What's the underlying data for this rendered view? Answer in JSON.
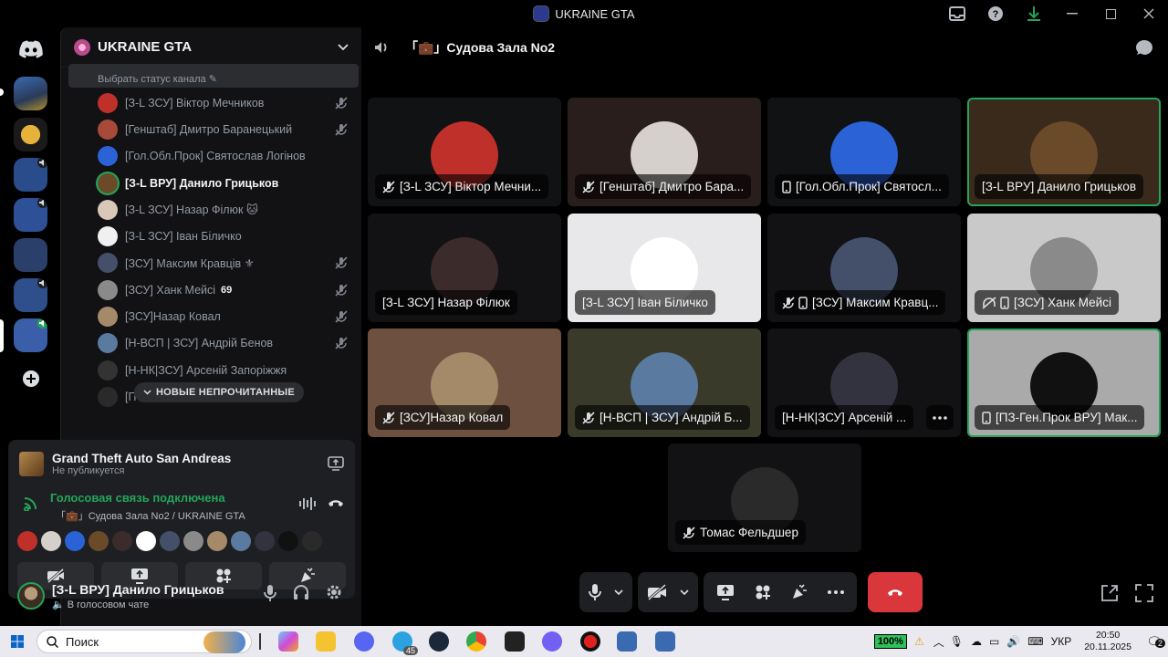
{
  "window": {
    "title": "UKRAINE GTA"
  },
  "guild": {
    "name": "UKRAINE GTA",
    "channel_status_placeholder": "Выбрать статус канала"
  },
  "members": [
    {
      "name": "[З-L ЗСУ] Віктор Мечников",
      "muted": true,
      "bold": false,
      "color": "#c0302a"
    },
    {
      "name": "[Генштаб] Дмитро Баранецький",
      "muted": true,
      "bold": false,
      "color": "#a84a3a"
    },
    {
      "name": "[Гол.Обл.Прок] Святослав Логінов",
      "muted": false,
      "bold": false,
      "color": "#2b62d6"
    },
    {
      "name": "[З-L ВРУ] Данило Грицьков",
      "muted": false,
      "bold": true,
      "color": "#6b4a2a"
    },
    {
      "name": "[З-L ЗСУ] Назар Філюк 🐱",
      "muted": false,
      "bold": false,
      "color": "#d9c7b8"
    },
    {
      "name": "[З-L ЗСУ] Іван Біличко",
      "muted": false,
      "bold": false,
      "color": "#f0f0f0"
    },
    {
      "name": "[ЗСУ] Максим Кравців ⚜",
      "muted": true,
      "bold": false,
      "color": "#44506a"
    },
    {
      "name": "[ЗСУ] Ханк Мейсі",
      "muted": true,
      "bold": false,
      "color": "#8a8a8a",
      "badge": "69"
    },
    {
      "name": "[ЗСУ]Назар Ковал",
      "muted": true,
      "bold": false,
      "color": "#a58a6a"
    },
    {
      "name": "[Н-ВСП | ЗСУ] Андрій Бенов",
      "muted": true,
      "bold": false,
      "color": "#5a7aa0"
    },
    {
      "name": "[Н-НК|ЗСУ] Арсеній Запоріжжя",
      "muted": false,
      "bold": false,
      "color": "#333"
    },
    {
      "name": "[П                    ісон",
      "muted": false,
      "bold": false,
      "color": "#2a2a2a"
    }
  ],
  "unread_banner": "НОВЫЕ НЕПРОЧИТАННЫЕ",
  "activity": {
    "game": "Grand Theft Auto San Andreas",
    "status": "Не публикуется"
  },
  "voice": {
    "status": "Голосовая связь подключена",
    "channel": "「💼」Судова Зала No2 / UKRAINE GTA"
  },
  "user": {
    "name": "[З-L ВРУ] Данило Грицьков",
    "status": "В голосовом чате"
  },
  "stage": {
    "channel_title": "「💼」Судова Зала No2"
  },
  "tiles": [
    {
      "label": "[З-L ЗСУ] Віктор Мечни...",
      "icon": "mic-off",
      "bg": "#111214",
      "av": "#c0302a",
      "speaking": false,
      "dots": false
    },
    {
      "label": "[Генштаб] Дмитро Бара...",
      "icon": "mic-off",
      "bg": "#2a1e1c",
      "av": "#d6d0cc",
      "speaking": false,
      "dots": false
    },
    {
      "label": "[Гол.Обл.Прок] Святосл...",
      "icon": "phone",
      "bg": "#111214",
      "av": "#2b62d6",
      "speaking": false,
      "dots": false
    },
    {
      "label": "[З-L ВРУ] Данило Грицьков",
      "icon": "",
      "bg": "#3a2a1c",
      "av": "#6b4a2a",
      "speaking": true,
      "dots": false
    },
    {
      "label": "[З-L ЗСУ] Назар Філюк",
      "icon": "",
      "bg": "#121214",
      "av": "#3b2b2b",
      "speaking": false,
      "dots": false
    },
    {
      "label": "[З-L ЗСУ] Іван Біличко",
      "icon": "",
      "bg": "#e8e8ea",
      "av": "#ffffff",
      "speaking": false,
      "dots": false
    },
    {
      "label": "[ЗСУ] Максим Кравц...",
      "icon": "mic-off-phone",
      "bg": "#121214",
      "av": "#44506a",
      "speaking": false,
      "dots": false
    },
    {
      "label": "[ЗСУ] Ханк Мейсі",
      "icon": "deaf-phone",
      "bg": "#c9c9c9",
      "av": "#8a8a8a",
      "speaking": false,
      "dots": false
    },
    {
      "label": "[ЗСУ]Назар Ковал",
      "icon": "mic-off",
      "bg": "#6e5040",
      "av": "#a58a6a",
      "speaking": false,
      "dots": false
    },
    {
      "label": "[Н-ВСП | ЗСУ] Андрій Б...",
      "icon": "mic-off",
      "bg": "#3a3a2a",
      "av": "#5a7aa0",
      "speaking": false,
      "dots": false
    },
    {
      "label": "[Н-НК|ЗСУ] Арсеній ...",
      "icon": "",
      "bg": "#121214",
      "av": "#333340",
      "speaking": false,
      "dots": true
    },
    {
      "label": "[ПЗ-Ген.Прок ВРУ] Мак...",
      "icon": "phone",
      "bg": "#aaaaaa",
      "av": "#111111",
      "speaking": true,
      "dots": false
    },
    {
      "label": "Томас Фельдшер",
      "icon": "mic-off",
      "bg": "#121214",
      "av": "#2a2a2a",
      "speaking": false,
      "dots": false
    }
  ],
  "taskbar": {
    "search_placeholder": "Поиск",
    "battery": "100%",
    "lang": "УКР",
    "time": "20:50",
    "date": "20.11.2025",
    "notif_count": "2",
    "telegram_badge": "45"
  }
}
